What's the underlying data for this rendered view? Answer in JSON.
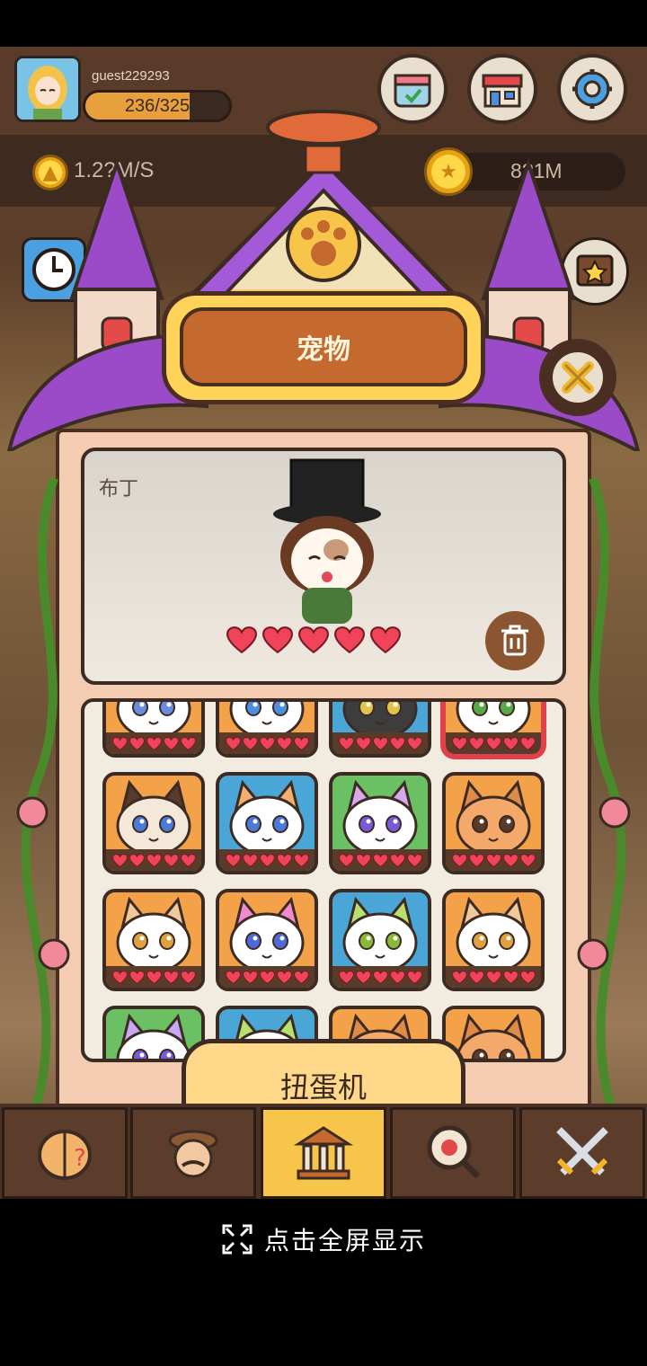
{
  "player": {
    "username": "guest229293",
    "xp_text": "236/325",
    "xp_fraction": 0.726
  },
  "stats": {
    "rate": "1.2?M/S",
    "coins": "8?1M"
  },
  "panel": {
    "title": "宠物",
    "close_icon": "close-x-icon"
  },
  "pet": {
    "name": "布丁",
    "hearts_filled": 5,
    "hearts_total": 5
  },
  "grid": {
    "pets": [
      {
        "bg": "#f4a24a",
        "face": "#ffffff",
        "ear": "#f8d7e8",
        "eye": "#6a8be0",
        "selected": false
      },
      {
        "bg": "#f4a24a",
        "face": "#ffffff",
        "ear": "#f0e6dc",
        "eye": "#4c8fe0",
        "selected": false
      },
      {
        "bg": "#4aa6d6",
        "face": "#3d3d3d",
        "ear": "#2a2a2a",
        "eye": "#e3c44a",
        "selected": false
      },
      {
        "bg": "#f4a24a",
        "face": "#ffffff",
        "ear": "#c8754a",
        "eye": "#58a84a",
        "selected": true
      },
      {
        "bg": "#f4a24a",
        "face": "#f4e8d8",
        "ear": "#5a3a2a",
        "eye": "#4c7ad8",
        "selected": false
      },
      {
        "bg": "#4aa6d6",
        "face": "#ffffff",
        "ear": "#f2b070",
        "eye": "#4c7ad8",
        "selected": false
      },
      {
        "bg": "#6cc064",
        "face": "#ffffff",
        "ear": "#d8a8e8",
        "eye": "#7a5ad8",
        "selected": false
      },
      {
        "bg": "#f4a24a",
        "face": "#f4a86a",
        "ear": "#e08a4a",
        "eye": "#5a3a2a",
        "selected": false
      },
      {
        "bg": "#f4a24a",
        "face": "#ffffff",
        "ear": "#f0c89a",
        "eye": "#e0a040",
        "selected": false
      },
      {
        "bg": "#f4a24a",
        "face": "#ffffff",
        "ear": "#f28ad0",
        "eye": "#4c6ad8",
        "selected": false
      },
      {
        "bg": "#4aa6d6",
        "face": "#ffffff",
        "ear": "#b8e070",
        "eye": "#8ab838",
        "selected": false
      },
      {
        "bg": "#f4a24a",
        "face": "#ffffff",
        "ear": "#f0c89a",
        "eye": "#e0a040",
        "selected": false
      },
      {
        "bg": "#6cc064",
        "face": "#ffffff",
        "ear": "#c8a8f0",
        "eye": "#7a5ad8",
        "selected": false
      },
      {
        "bg": "#4aa6d6",
        "face": "#ffffff",
        "ear": "#b8e070",
        "eye": "#8ab838",
        "selected": false
      },
      {
        "bg": "#f4a24a",
        "face": "#f4a86a",
        "ear": "#e08a4a",
        "eye": "#5a3a2a",
        "selected": false
      },
      {
        "bg": "#f4a24a",
        "face": "#f4a86a",
        "ear": "#e08a4a",
        "eye": "#5a3a2a",
        "selected": false
      }
    ]
  },
  "gacha_button": "扭蛋机",
  "nav": [
    {
      "icon": "brain-question-icon",
      "active": false
    },
    {
      "icon": "detective-icon",
      "active": false
    },
    {
      "icon": "museum-icon",
      "active": true
    },
    {
      "icon": "magnifier-ladybug-icon",
      "active": false
    },
    {
      "icon": "crossed-swords-icon",
      "active": false
    }
  ],
  "fullscreen": {
    "label": "点击全屏显示",
    "icon": "expand-icon"
  },
  "top_buttons": [
    {
      "icon": "calendar-check-icon"
    },
    {
      "icon": "shop-icon"
    },
    {
      "icon": "settings-gear-icon"
    }
  ],
  "colors": {
    "heart": "#f0445a",
    "accent": "#c46a2f",
    "frame": "#4a2e21"
  }
}
